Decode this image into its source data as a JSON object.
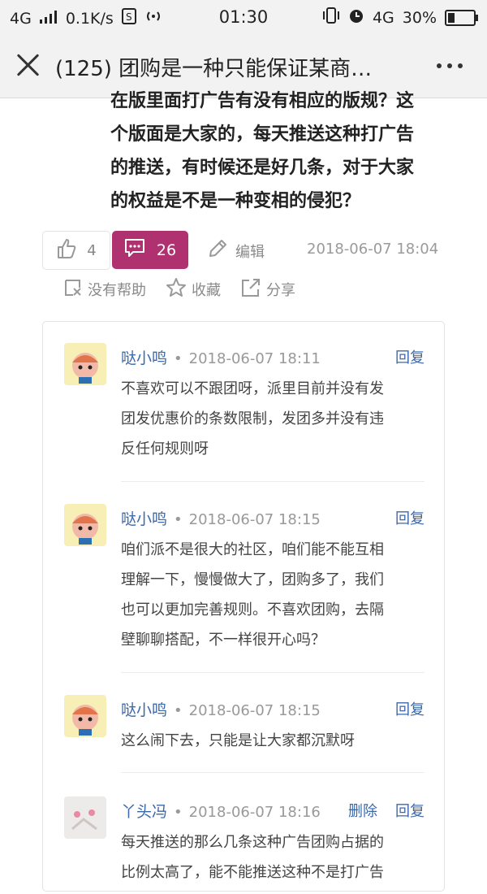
{
  "status_bar": {
    "network": "4G",
    "speed": "0.1K/s",
    "time": "01:30",
    "net_right": "4G",
    "battery": "30%"
  },
  "nav": {
    "title": "(125) 团购是一种只能保证某商…"
  },
  "article": {
    "lines": [
      "在版里面打广告有没有相应的版规？这",
      "个版面是大家的，每天推送这种打广告",
      "的推送，有时候还是好几条，对于大家",
      "的权益是不是一种变相的侵犯？"
    ]
  },
  "actions": {
    "likes": "4",
    "comments": "26",
    "edit_label": "编辑",
    "post_time": "2018-06-07 18:04",
    "not_helpful": "没有帮助",
    "favorite": "收藏",
    "share": "分享"
  },
  "comments": [
    {
      "author": "哒小鸣",
      "time": "2018-06-07 18:11",
      "reply": "回复",
      "lines": [
        "不喜欢可以不跟团呀，派里目前并没有发",
        "团发优惠价的条数限制，发团多并没有违",
        "反任何规则呀"
      ]
    },
    {
      "author": "哒小鸣",
      "time": "2018-06-07 18:15",
      "reply": "回复",
      "lines": [
        "咱们派不是很大的社区，咱们能不能互相",
        "理解一下，慢慢做大了，团购多了，我们",
        "也可以更加完善规则。不喜欢团购，去隔",
        "壁聊聊搭配，不一样很开心吗？"
      ]
    },
    {
      "author": "哒小鸣",
      "time": "2018-06-07 18:15",
      "reply": "回复",
      "lines": [
        "这么闹下去，只能是让大家都沉默呀"
      ]
    },
    {
      "author": "丫头冯",
      "time": "2018-06-07 18:16",
      "delete": "删除",
      "reply": "回复",
      "lines": [
        "每天推送的那么几条这种广告团购占据的",
        "比例太高了，能不能推送这种不是打广告"
      ]
    }
  ]
}
